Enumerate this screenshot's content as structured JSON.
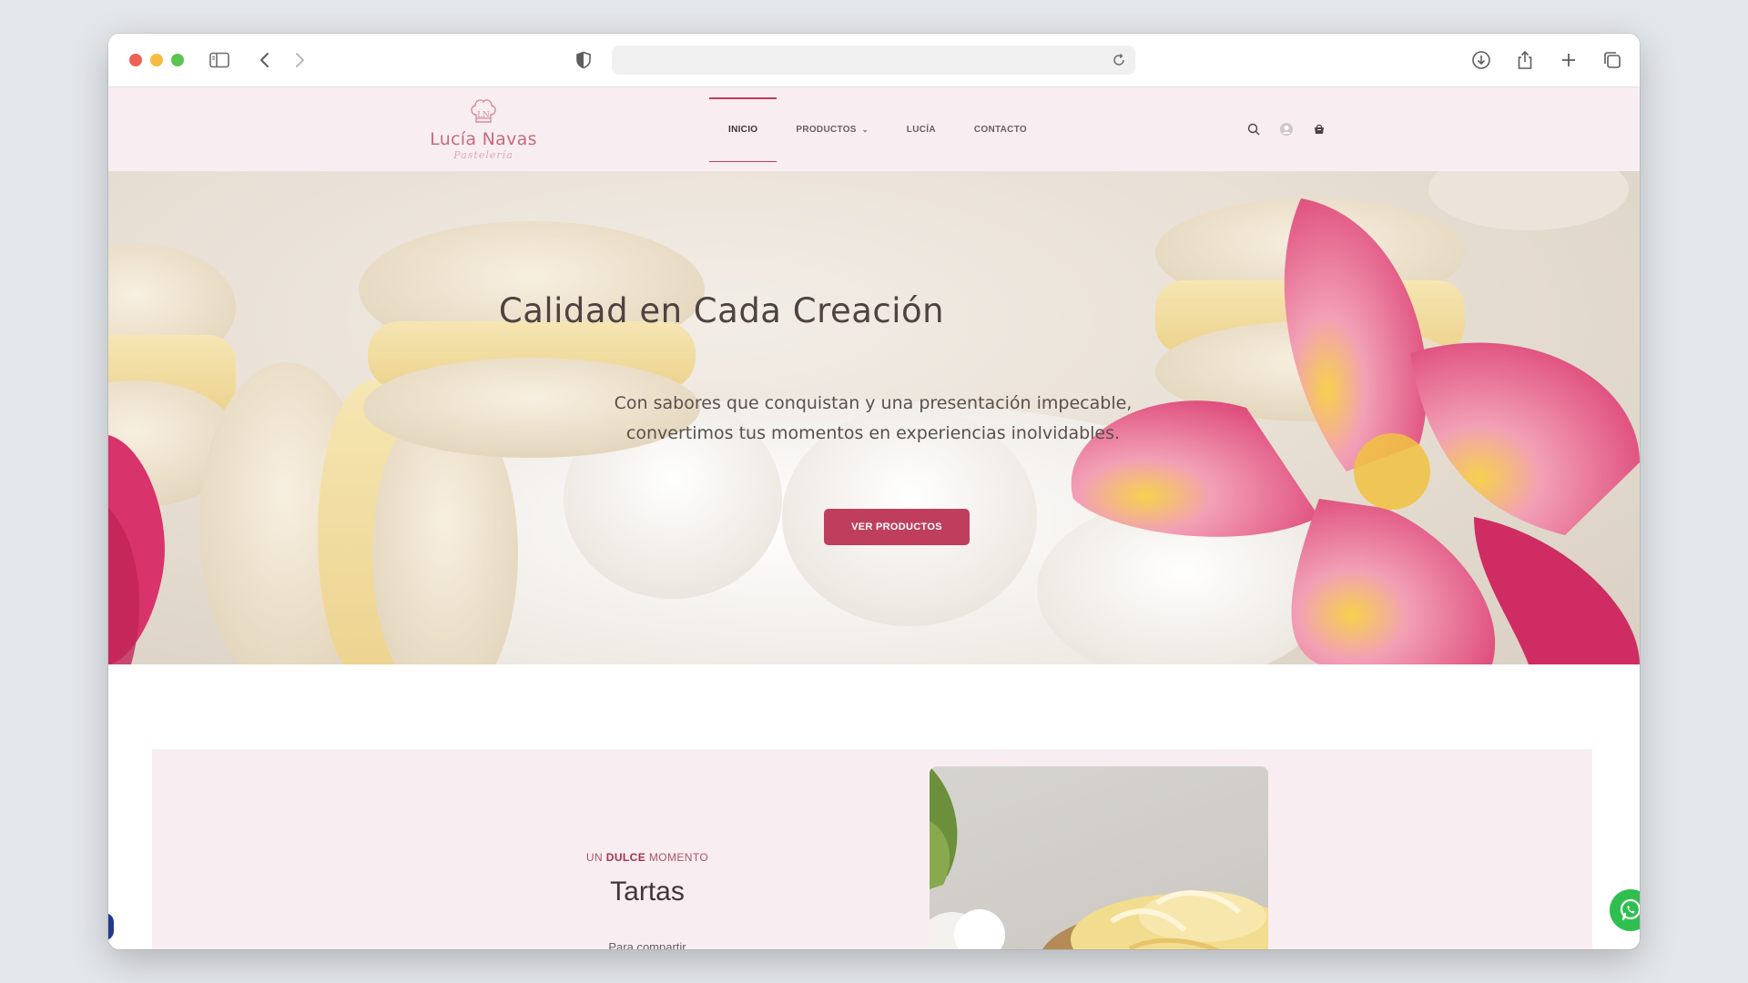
{
  "browser": {
    "url": "",
    "icons": [
      "sidebar-icon",
      "back-icon",
      "forward-icon",
      "shield-icon",
      "reload-icon",
      "download-icon",
      "share-icon",
      "new-tab-icon",
      "tabs-overview-icon"
    ]
  },
  "site": {
    "logo": {
      "name": "Lucía Navas",
      "subtitle": "Pastelería"
    },
    "nav": [
      {
        "label": "INICIO",
        "active": true
      },
      {
        "label": "PRODUCTOS",
        "dropdown": true
      },
      {
        "label": "LUCÍA"
      },
      {
        "label": "CONTACTO"
      }
    ],
    "header_icons": [
      "search-icon",
      "account-icon",
      "cart-icon"
    ]
  },
  "hero": {
    "title": "Calidad en Cada Creación",
    "subtitle_line1": "Con sabores que conquistan y una presentación impecable,",
    "subtitle_line2": "convertimos tus momentos en experiencias inolvidables.",
    "button": "VER PRODUCTOS"
  },
  "section": {
    "eyebrow_pre": "UN ",
    "eyebrow_bold": "DULCE",
    "eyebrow_post": " MOMENTO",
    "title": "Tartas",
    "desc": "Para compartir"
  },
  "colors": {
    "accent": "#bf3e5e",
    "header_bg": "#f8eef2",
    "whatsapp": "#2fbf4f"
  }
}
